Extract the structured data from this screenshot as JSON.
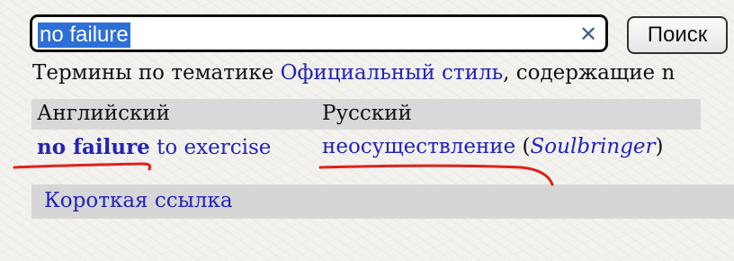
{
  "search": {
    "value": "no failure",
    "button_label": "Поиск",
    "clear_icon": "close-icon"
  },
  "intro": {
    "prefix": "Термины по тематике ",
    "topic": "Официальный стиль",
    "suffix": ", содержащие n"
  },
  "table": {
    "headers": [
      "Английский",
      "Русский"
    ],
    "rows": [
      {
        "en_match": "no failure",
        "en_rest": " to exercise",
        "ru_term": "неосуществление",
        "ru_open": " (",
        "ru_author": "Soulbringer",
        "ru_close": ")"
      }
    ]
  },
  "short_link": "Короткая ссылка",
  "colors": {
    "link": "#2323b8",
    "highlight": "#2d6fd6",
    "annotation": "#e0201c"
  }
}
